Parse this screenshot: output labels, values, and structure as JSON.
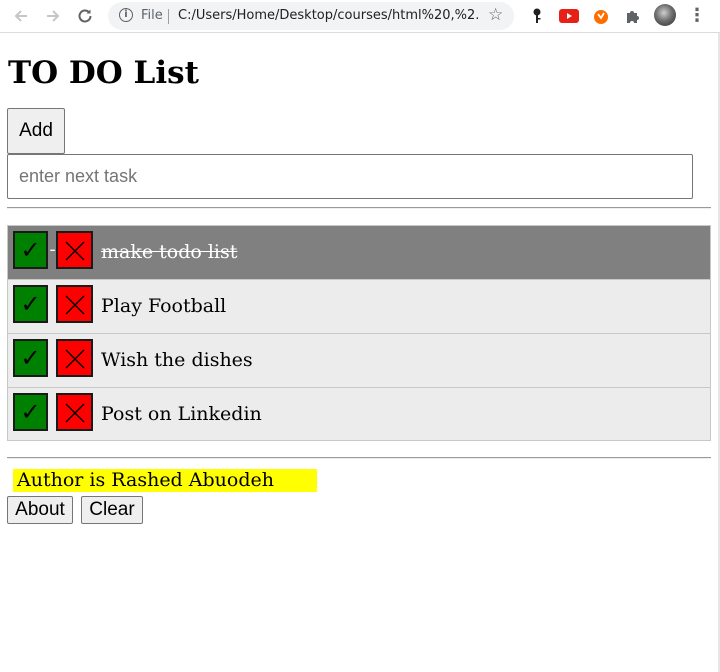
{
  "browser": {
    "file_label": "File",
    "url": "C:/Users/Home/Desktop/courses/html%20,%2..."
  },
  "page": {
    "title": "TO DO List",
    "add_label": "Add",
    "input": {
      "placeholder": "enter next task",
      "value": ""
    },
    "tasks": [
      {
        "text": "make todo list",
        "done": true
      },
      {
        "text": "Play Football",
        "done": false
      },
      {
        "text": "Wish the dishes",
        "done": false
      },
      {
        "text": "Post on Linkedin",
        "done": false
      }
    ],
    "author": "Author is Rashed Abuodeh",
    "about_label": "About",
    "clear_label": "Clear"
  },
  "colors": {
    "check_button": "#008000",
    "delete_button": "#ff0000",
    "done_row": "#808080",
    "row": "#ececec",
    "author_highlight": "#ffff00"
  }
}
